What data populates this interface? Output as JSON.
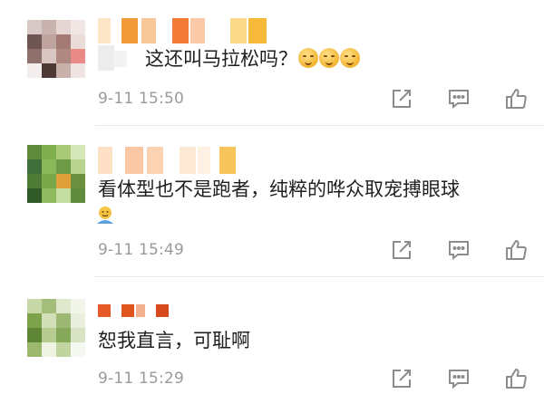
{
  "comments": [
    {
      "text": "这还叫马拉松吗？",
      "emoji_icons": [
        "emoji-icon",
        "emoji-icon",
        "emoji-icon"
      ],
      "timestamp": "9-11 15:50"
    },
    {
      "text": "看体型也不是跑者，纯粹的哗众取宠搏眼球",
      "emoji_icons": [
        "emoji-icon"
      ],
      "timestamp": "9-11 15:49"
    },
    {
      "text": "恕我直言，可耻啊",
      "emoji_icons": [],
      "timestamp": "9-11 15:29"
    }
  ],
  "action_icons": [
    "share-icon",
    "comment-icon",
    "like-icon"
  ],
  "colors": {
    "text": "#1f1f1f",
    "meta": "#9a9a9a",
    "icon": "#8c8c8c",
    "divider": "#e8e8e8"
  }
}
